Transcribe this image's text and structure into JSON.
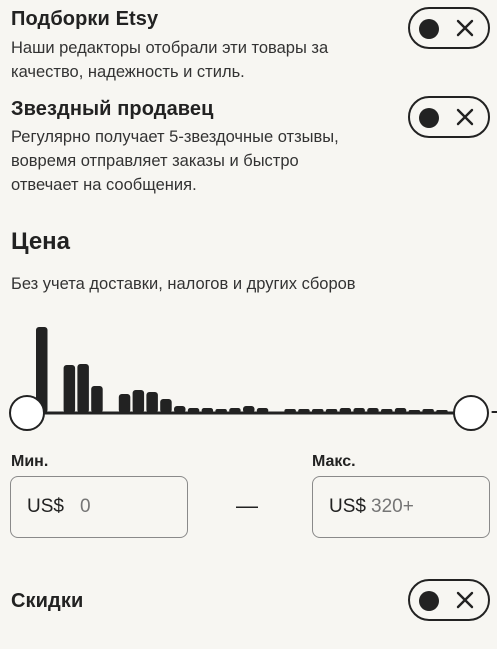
{
  "filters": {
    "etsy_picks": {
      "title": "Подборки Etsy",
      "desc_line1": "Наши редакторы отобрали эти товары за",
      "desc_line2": "качество, надежность и стиль."
    },
    "star_seller": {
      "title": "Звездный продавец",
      "desc_line1": "Регулярно получает 5-звездочные отзывы,",
      "desc_line2": "вовремя отправляет заказы и быстро",
      "desc_line3": "отвечает на сообщения."
    },
    "price": {
      "title": "Цена",
      "subtitle": "Без учета доставки, налогов и других сборов",
      "histogram": [
        86,
        0,
        48,
        49,
        27,
        0,
        19,
        23,
        21,
        14,
        7,
        5,
        5,
        4,
        5,
        7,
        5,
        0,
        4,
        4,
        4,
        4,
        5,
        5,
        5,
        4,
        5,
        3,
        4,
        3,
        0,
        0,
        0,
        2,
        0,
        2,
        3,
        0,
        3,
        0,
        0,
        0,
        0,
        0,
        3,
        3,
        0,
        3,
        3,
        3,
        4,
        4,
        0,
        3
      ],
      "min_label": "Мин.",
      "max_label": "Макс.",
      "currency": "US$",
      "min_value": "0",
      "max_value": "320+",
      "separator": "—",
      "slider_min_fraction": 0,
      "slider_max_fraction": 1
    },
    "discounts": {
      "title": "Скидки"
    }
  },
  "colors": {
    "background": "#f7f6f2",
    "text": "#222222",
    "bars": "#222222"
  },
  "icons": {
    "toggle_off": "close-icon"
  }
}
